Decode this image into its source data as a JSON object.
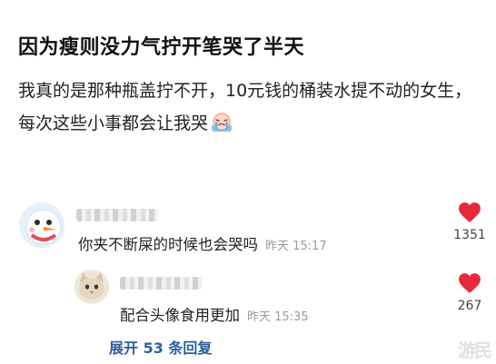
{
  "post": {
    "title": "因为瘦则没力气拧开笔哭了半天",
    "body": "我真的是那种瓶盖拧不开，10元钱的桶装水提不动的女生，每次这些小事都会让我哭",
    "emoji_icon": "crying-face-icon"
  },
  "comments": [
    {
      "text": "你夹不断屎的时候也会哭吗",
      "time": "昨天 15:17",
      "likes": "1351",
      "avatar_icon": "snowman-avatar-icon"
    },
    {
      "text": "配合头像食用更加",
      "time": "昨天 15:35",
      "likes": "267",
      "avatar_icon": "cat-avatar-icon"
    }
  ],
  "expand_replies_label": "展开 53 条回复",
  "watermark": "游民",
  "colors": {
    "like_heart": "#e8283a",
    "link_blue": "#2d5e9e",
    "time_gray": "#999999"
  }
}
